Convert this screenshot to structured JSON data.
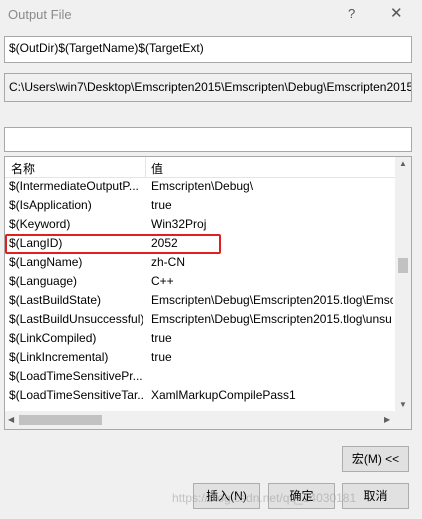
{
  "window": {
    "title": "Output File",
    "help_glyph": "?",
    "close_glyph": "✕"
  },
  "fields": {
    "expression": "$(OutDir)$(TargetName)$(TargetExt)",
    "evaluated": "C:\\Users\\win7\\Desktop\\Emscripten2015\\Emscripten\\Debug\\Emscripten2015",
    "filter": ""
  },
  "grid": {
    "columns": [
      "名称",
      "值"
    ],
    "rows": [
      {
        "name": "$(IntermediateOutputP...",
        "value": "Emscripten\\Debug\\"
      },
      {
        "name": "$(IsApplication)",
        "value": "true"
      },
      {
        "name": "$(Keyword)",
        "value": "Win32Proj"
      },
      {
        "name": "$(LangID)",
        "value": "2052"
      },
      {
        "name": "$(LangName)",
        "value": "zh-CN"
      },
      {
        "name": "$(Language)",
        "value": "C++"
      },
      {
        "name": "$(LastBuildState)",
        "value": "Emscripten\\Debug\\Emscripten2015.tlog\\Emsc"
      },
      {
        "name": "$(LastBuildUnsuccessful)",
        "value": "Emscripten\\Debug\\Emscripten2015.tlog\\unsu"
      },
      {
        "name": "$(LinkCompiled)",
        "value": "true"
      },
      {
        "name": "$(LinkIncremental)",
        "value": "true"
      },
      {
        "name": "$(LoadTimeSensitivePr...",
        "value": ""
      },
      {
        "name": "$(LoadTimeSensitiveTar...",
        "value": "XamlMarkupCompilePass1"
      }
    ],
    "highlight_color": "#e0201f"
  },
  "buttons": {
    "macros": "宏(M) <<",
    "insert": "插入(N)",
    "ok": "确定",
    "cancel": "取消"
  },
  "watermark": "https://blog.csdn.net/qq_14030181"
}
